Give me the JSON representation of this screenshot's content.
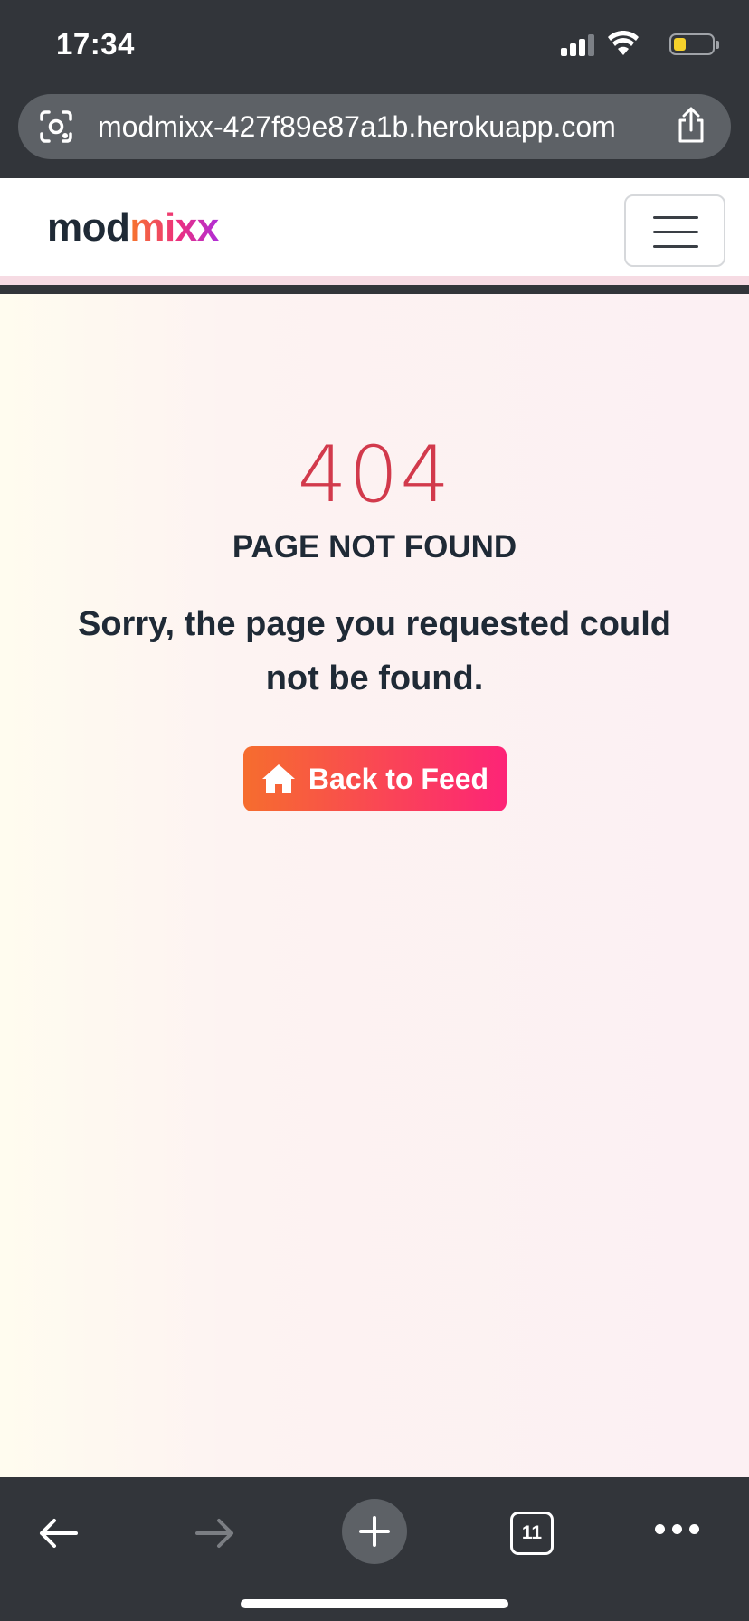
{
  "status_bar": {
    "time": "17:34",
    "icons": [
      "signal-icon",
      "wifi-icon",
      "battery-icon"
    ],
    "battery_color": "#f5d12b"
  },
  "browser": {
    "url": "modmixx-427f89e87a1b.herokuapp.com",
    "icons": [
      "lens-icon",
      "share-icon"
    ]
  },
  "navbar": {
    "brand_part1": "mod",
    "brand_part2": "mixx",
    "menu_icon": "hamburger-icon"
  },
  "error": {
    "code": "404",
    "title": "PAGE NOT FOUND",
    "message": "Sorry, the page you requested could not be found.",
    "button_label": "Back to Feed",
    "button_icon": "home-icon"
  },
  "toolbar": {
    "tab_count": "11",
    "icons": [
      "back-arrow-icon",
      "forward-arrow-icon",
      "plus-icon",
      "tabs-icon",
      "more-icon"
    ]
  },
  "colors": {
    "accent_start": "#f66d2e",
    "accent_end": "#fd2477",
    "error_code": "#d23a4c",
    "text_dark": "#1f2a36",
    "browser_chrome": "#32353a"
  }
}
